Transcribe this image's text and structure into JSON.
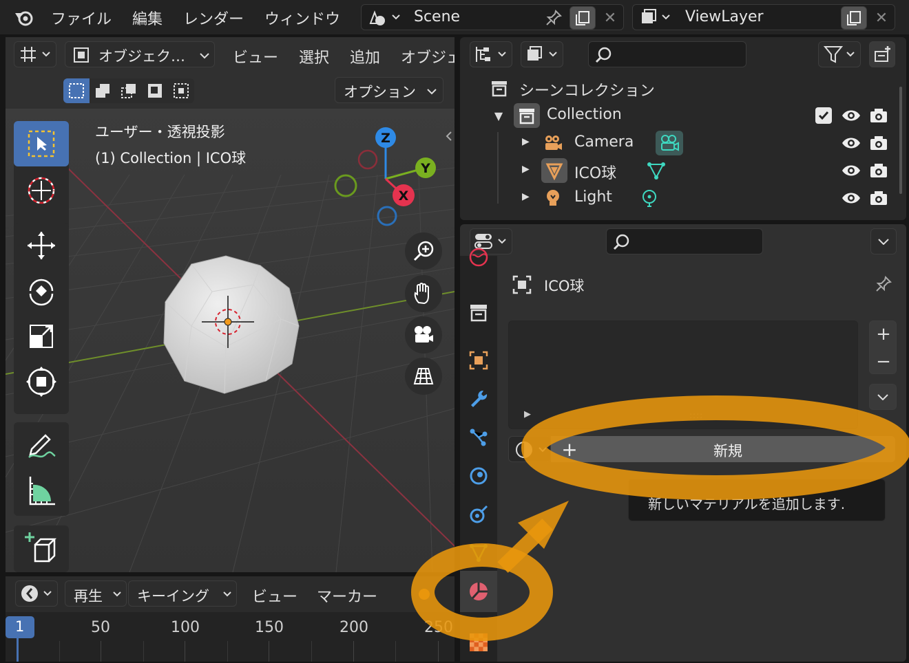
{
  "topbar": {
    "menu": [
      "ファイル",
      "編集",
      "レンダー",
      "ウィンドウ"
    ],
    "scene_name": "Scene",
    "view_layer_name": "ViewLayer"
  },
  "viewport_header": {
    "mode_label": "オブジェク…",
    "menu": [
      "ビュー",
      "選択",
      "追加",
      "オブジェ"
    ],
    "options_label": "オプション"
  },
  "viewport": {
    "view_label": "ユーザー・透視投影",
    "object_info": "(1) Collection | ICO球",
    "gizmo_axes": [
      "Z",
      "Y",
      "X"
    ]
  },
  "outliner": {
    "root_label": "シーンコレクション",
    "collection_label": "Collection",
    "objects": [
      {
        "name": "Camera",
        "icon": "camera-object-icon",
        "color": "#e8a05a"
      },
      {
        "name": "ICO球",
        "icon": "mesh-object-icon",
        "color": "#e8a05a"
      },
      {
        "name": "Light",
        "icon": "light-object-icon",
        "color": "#e8a05a"
      }
    ]
  },
  "properties": {
    "object_name": "ICO球",
    "new_button_label": "新規",
    "tooltip": "新しいマテリアルを追加します.",
    "tabs": [
      "world",
      "collection",
      "object",
      "modifier",
      "particles",
      "physics",
      "constraints",
      "data",
      "material",
      "texture"
    ]
  },
  "timeline": {
    "menu": [
      "再生",
      "キーイング",
      "ビュー",
      "マーカー"
    ],
    "current_frame": "1",
    "ruler": [
      "50",
      "100",
      "150",
      "200",
      "250"
    ]
  },
  "colors": {
    "accent_blue": "#4772b3",
    "highlight_orange": "#e8960c",
    "axis_x": "#e5334f",
    "axis_y": "#7ab020",
    "axis_z": "#2e8ae6"
  }
}
